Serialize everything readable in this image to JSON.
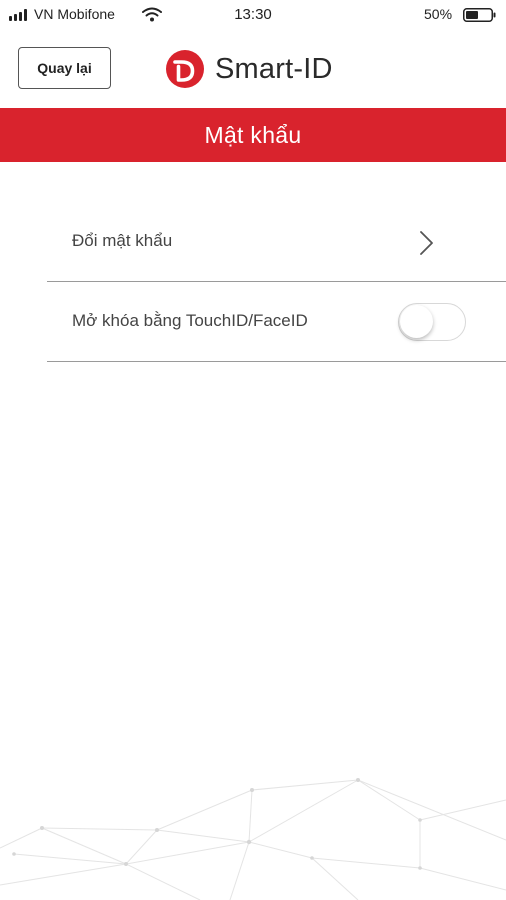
{
  "status_bar": {
    "carrier": "VN Mobifone",
    "time": "13:30",
    "battery_percent": "50%",
    "battery_level": 0.5,
    "icons": [
      "signal-icon",
      "wifi-icon",
      "battery-icon"
    ]
  },
  "header": {
    "back_label": "Quay lại",
    "brand_name": "Smart-ID",
    "logo_icon": "smart-id-logo"
  },
  "page": {
    "title": "Mật khẩu"
  },
  "menu": {
    "items": [
      {
        "label": "Đổi mật khẩu",
        "control": "chevron-right-icon"
      },
      {
        "label": "Mở khóa bằng TouchID/FaceID",
        "control": "toggle",
        "enabled": false
      }
    ]
  },
  "colors": {
    "accent": "#d9232d",
    "text": "#444444",
    "divider": "#9a9a9a",
    "background": "#ffffff"
  }
}
